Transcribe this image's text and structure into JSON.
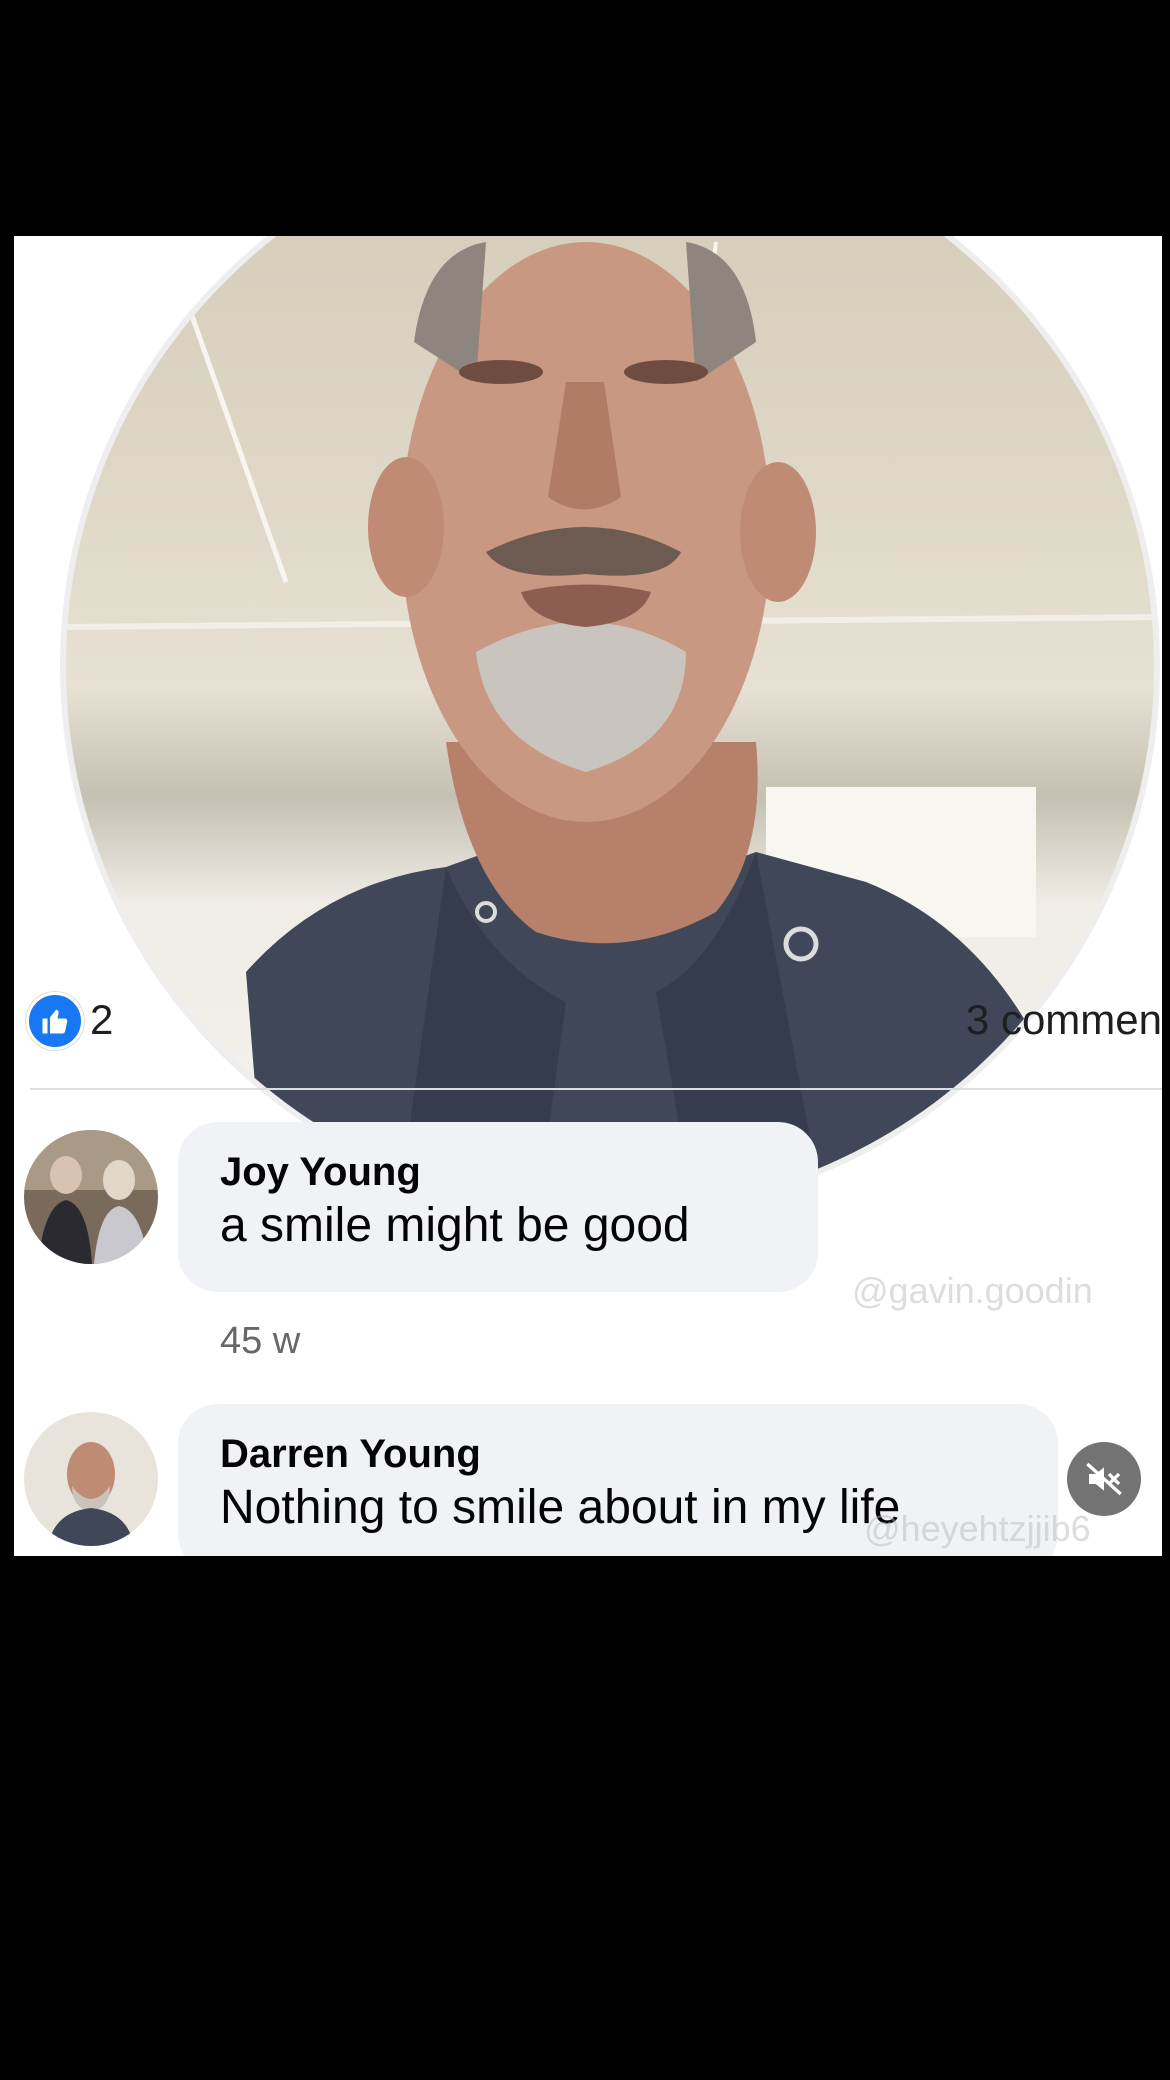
{
  "post": {
    "reactions": {
      "icon": "like-icon",
      "count": "2"
    },
    "comment_count_label": "3 commen"
  },
  "comments": [
    {
      "author": "Joy Young",
      "text": "a smile might be good",
      "time": "45 w"
    },
    {
      "author": "Darren Young",
      "text": "Nothing to smile about in my life"
    }
  ],
  "overlay": {
    "watermarks": [
      "@gavin.goodin",
      "@heyehtzjjib6"
    ],
    "mute_icon": "speaker-muted-icon"
  },
  "colors": {
    "like_blue": "#1877f2",
    "bubble": "#f0f2f5",
    "meta_text": "#65676b"
  }
}
